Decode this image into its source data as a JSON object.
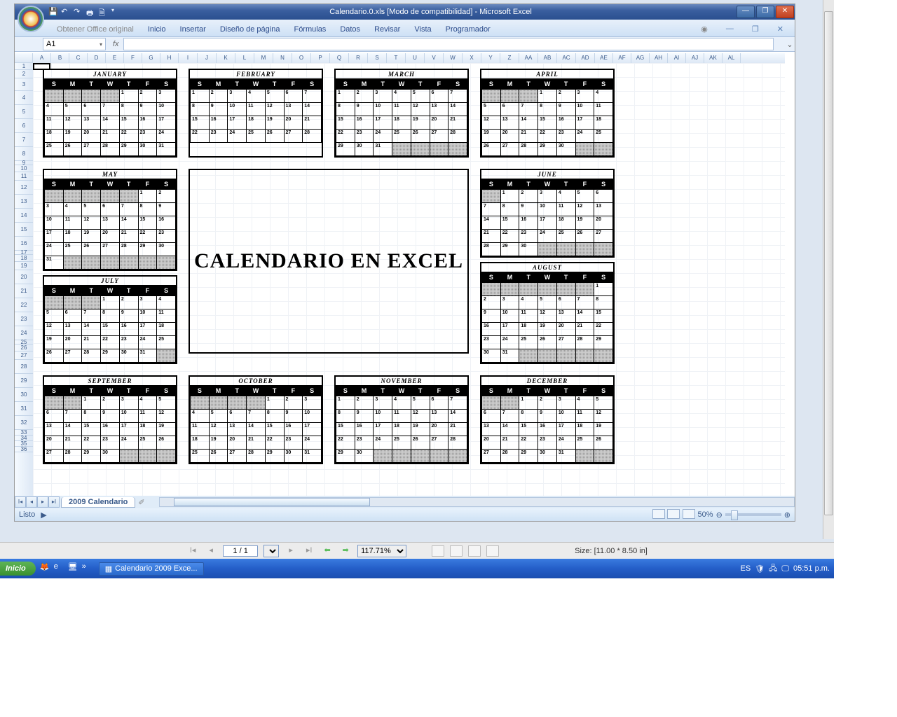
{
  "window": {
    "title": "Calendario.0.xls  [Modo de compatibilidad] - Microsoft Excel"
  },
  "ribbon": {
    "office_original": "Obtener Office original",
    "tabs": [
      "Inicio",
      "Insertar",
      "Diseño de página",
      "Fórmulas",
      "Datos",
      "Revisar",
      "Vista",
      "Programador"
    ]
  },
  "namebox": "A1",
  "sheet_tab": "2009 Calendario",
  "status": "Listo",
  "zoom": "50%",
  "center_text": "CALENDARIO EN EXCEL",
  "columns": [
    "A",
    "B",
    "C",
    "D",
    "E",
    "F",
    "G",
    "H",
    "I",
    "J",
    "K",
    "L",
    "M",
    "N",
    "O",
    "P",
    "Q",
    "R",
    "S",
    "T",
    "U",
    "V",
    "W",
    "X",
    "Y",
    "Z",
    "AA",
    "AB",
    "AC",
    "AD",
    "AE",
    "AF",
    "AG",
    "AH",
    "AI",
    "AJ",
    "AK",
    "AL"
  ],
  "days": [
    "S",
    "M",
    "T",
    "W",
    "T",
    "F",
    "S"
  ],
  "months": {
    "jan": {
      "name": "JANUARY",
      "start": 4,
      "len": 31
    },
    "feb": {
      "name": "FEBRUARY",
      "start": 0,
      "len": 28
    },
    "mar": {
      "name": "MARCH",
      "start": 0,
      "len": 31
    },
    "apr": {
      "name": "APRIL",
      "start": 3,
      "len": 30
    },
    "may": {
      "name": "MAY",
      "start": 5,
      "len": 31
    },
    "jun": {
      "name": "JUNE",
      "start": 1,
      "len": 30
    },
    "jul": {
      "name": "JULY",
      "start": 3,
      "len": 31
    },
    "aug": {
      "name": "AUGUST",
      "start": 6,
      "len": 31
    },
    "sep": {
      "name": "SEPTEMBER",
      "start": 2,
      "len": 30
    },
    "oct": {
      "name": "OCTOBER",
      "start": 4,
      "len": 31
    },
    "nov": {
      "name": "NOVEMBER",
      "start": 0,
      "len": 30
    },
    "dec": {
      "name": "DECEMBER",
      "start": 2,
      "len": 31
    }
  },
  "page_nav": {
    "page": "1 / 1",
    "zoom": "117.71%",
    "size": "Size: [11.00 * 8.50 in]"
  },
  "taskbar": {
    "start": "Inicio",
    "task": "Calendario 2009 Exce...",
    "lang": "ES",
    "clock": "05:51 p.m."
  }
}
